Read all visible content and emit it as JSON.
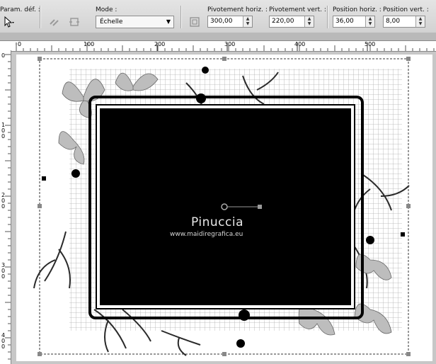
{
  "toolbar": {
    "presets_label": "Param. déf. :",
    "mode_label": "Mode :",
    "mode_value": "Échelle",
    "pivot_h_label": "Pivotement horiz. :",
    "pivot_h_value": "300,00",
    "pivot_v_label": "Pivotement vert. :",
    "pivot_v_value": "220,00",
    "pos_h_label": "Position horiz. :",
    "pos_h_value": "36,00",
    "pos_v_label": "Position vert. :",
    "pos_v_value": "8,00"
  },
  "ruler": {
    "top_labels": [
      "0",
      "100",
      "200",
      "300",
      "400",
      "500"
    ],
    "left_labels": [
      "0",
      "1 0 0",
      "2 0 0",
      "3 0 0",
      "4 0 0"
    ]
  },
  "canvas": {
    "watermark_name": "Pinuccia",
    "watermark_url": "www.maidiregrafica.eu"
  }
}
